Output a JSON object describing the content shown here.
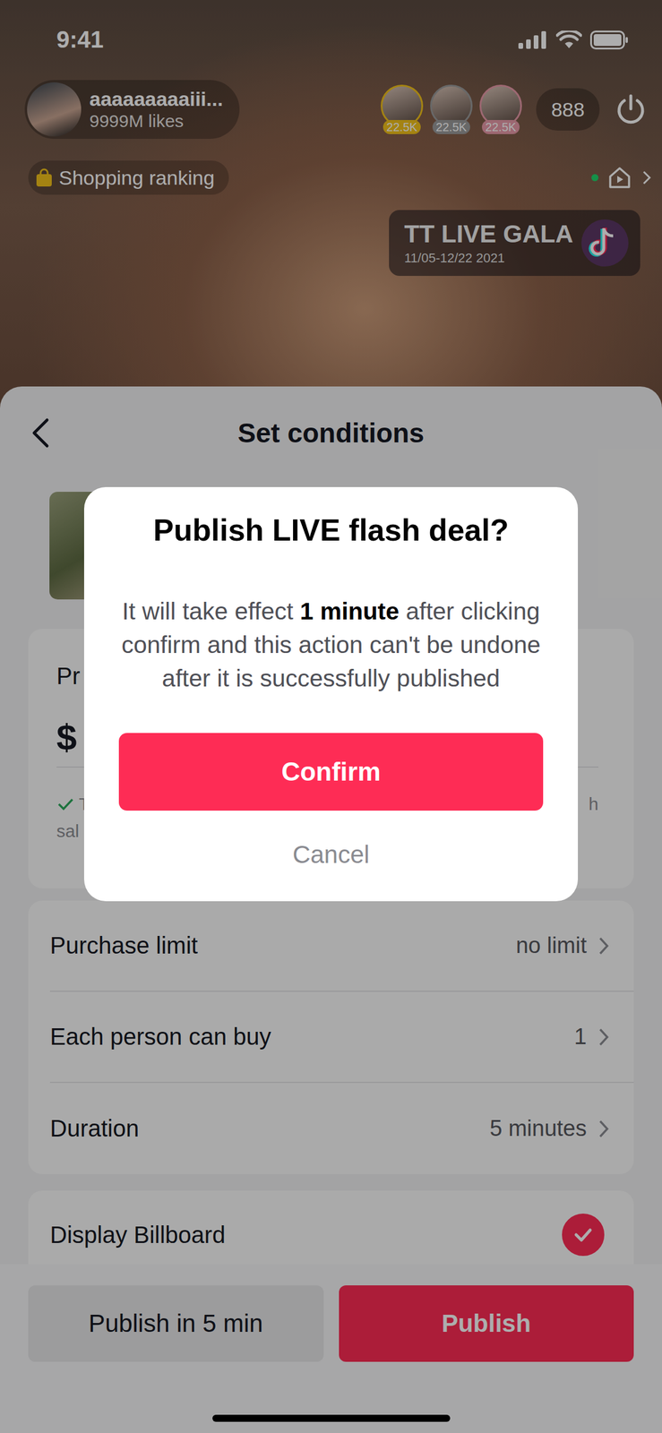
{
  "status_bar": {
    "time": "9:41"
  },
  "host": {
    "name": "aaaaaaaaaiii...",
    "likes": "9999M likes"
  },
  "viewers": [
    {
      "count": "22.5K",
      "color": "#f2c21b"
    },
    {
      "count": "22.5K",
      "color": "#9a9a9a"
    },
    {
      "count": "22.5K",
      "color": "#e79aa8"
    }
  ],
  "viewer_total": "888",
  "shopping_ranking": "Shopping ranking",
  "banner": {
    "title": "TT LIVE GALA",
    "dates": "11/05-12/22 2021"
  },
  "sheet": {
    "title": "Set conditions",
    "price_label": "Pr",
    "price_value": "$",
    "note_left": "T",
    "note_right": "h",
    "note_line2": "sal",
    "rows": [
      {
        "label": "Purchase limit",
        "value": "no limit"
      },
      {
        "label": "Each person can buy",
        "value": "1"
      },
      {
        "label": "Duration",
        "value": "5 minutes"
      }
    ],
    "billboard": {
      "label": "Display Billboard",
      "checked": true
    }
  },
  "footer": {
    "buttons": [
      {
        "label": "Publish in 5 min",
        "kind": "secondary"
      },
      {
        "label": "Publish",
        "kind": "primary"
      }
    ]
  },
  "dialog": {
    "title": "Publish LIVE flash deal?",
    "body_before": "It will take effect ",
    "body_bold": "1 minute",
    "body_after": " after clicking confirm and this action can't be undone after it is successfully published",
    "confirm": "Confirm",
    "cancel": "Cancel"
  }
}
